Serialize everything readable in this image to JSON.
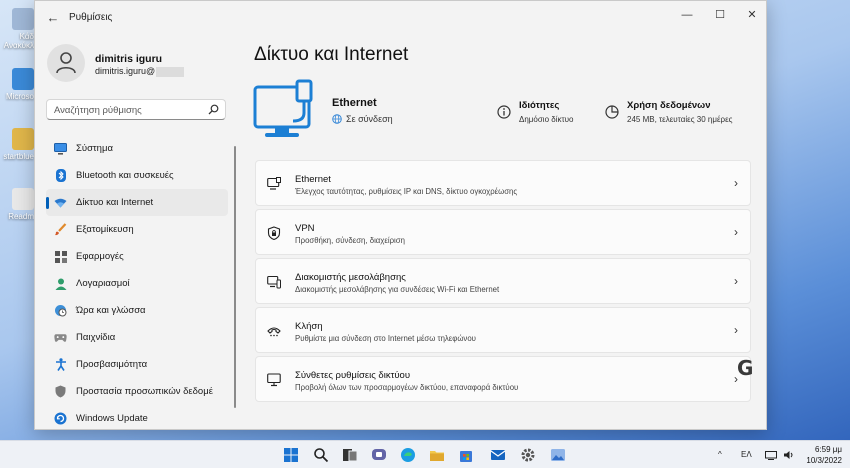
{
  "desktop": {
    "icons": [
      {
        "label": "Κάδ\nΑνακύκλ",
        "color": "#9fb7d6"
      },
      {
        "label": "Microso",
        "color": "#3b8ad8"
      },
      {
        "label": "startblue",
        "color": "#e0b64a"
      },
      {
        "label": "Readm",
        "color": "#e8e8e8"
      }
    ]
  },
  "window": {
    "app_title": "Ρυθμίσεις",
    "back_symbol": "←",
    "minimize_symbol": "—",
    "maximize_symbol": "☐",
    "close_symbol": "✕"
  },
  "user": {
    "name": "dimitris iguru",
    "email": "dimitris.iguru@"
  },
  "search": {
    "placeholder": "Αναζήτηση ρύθμισης"
  },
  "sidebar": {
    "items": [
      {
        "label": "Σύστημα",
        "icon": "monitor-icon",
        "active": false
      },
      {
        "label": "Bluetooth και συσκευές",
        "icon": "bluetooth-icon",
        "active": false
      },
      {
        "label": "Δίκτυο και Internet",
        "icon": "wifi-icon",
        "active": true
      },
      {
        "label": "Εξατομίκευση",
        "icon": "brush-icon",
        "active": false
      },
      {
        "label": "Εφαρμογές",
        "icon": "apps-icon",
        "active": false
      },
      {
        "label": "Λογαριασμοί",
        "icon": "person-icon",
        "active": false
      },
      {
        "label": "Ώρα και γλώσσα",
        "icon": "globe-clock-icon",
        "active": false
      },
      {
        "label": "Παιχνίδια",
        "icon": "gamepad-icon",
        "active": false
      },
      {
        "label": "Προσβασιμότητα",
        "icon": "accessibility-icon",
        "active": false
      },
      {
        "label": "Προστασία προσωπικών δεδομέ",
        "icon": "shield-icon",
        "active": false
      },
      {
        "label": "Windows Update",
        "icon": "update-icon",
        "active": false
      }
    ]
  },
  "main": {
    "page_title": "Δίκτυο και Internet",
    "connection": {
      "name": "Ethernet",
      "status": "Σε σύνδεση"
    },
    "properties": {
      "title": "Ιδιότητες",
      "subtitle": "Δημόσιο δίκτυο"
    },
    "data_usage": {
      "title": "Χρήση δεδομένων",
      "subtitle": "245 MB, τελευταίες 30 ημέρες"
    },
    "cards": [
      {
        "title": "Ethernet",
        "subtitle": "Έλεγχος ταυτότητας, ρυθμίσεις IP και DNS, δίκτυο ογκοχρέωσης",
        "icon": "ethernet-icon"
      },
      {
        "title": "VPN",
        "subtitle": "Προσθήκη, σύνδεση, διαχείριση",
        "icon": "vpn-shield-icon"
      },
      {
        "title": "Διακομιστής μεσολάβησης",
        "subtitle": "Διακομιστής μεσολάβησης για συνδέσεις Wi-Fi και Ethernet",
        "icon": "proxy-icon"
      },
      {
        "title": "Κλήση",
        "subtitle": "Ρυθμίστε μια σύνδεση στο Internet μέσω τηλεφώνου",
        "icon": "dialup-icon"
      },
      {
        "title": "Σύνθετες ρυθμίσεις δικτύου",
        "subtitle": "Προβολή όλων των προσαρμογέων δικτύου, επαναφορά δικτύου",
        "icon": "advanced-network-icon"
      }
    ],
    "chevron": "›"
  },
  "watermark": "G",
  "taskbar": {
    "language": "ΕΛ",
    "time": "6:59 μμ",
    "date": "10/3/2022",
    "tray_chevron": "^"
  },
  "colors": {
    "accent": "#005fb8",
    "hero_blue": "#1c7fd4"
  }
}
